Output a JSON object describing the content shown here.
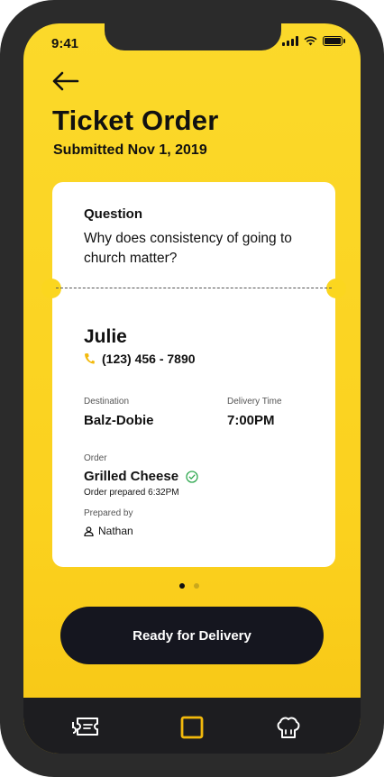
{
  "status": {
    "time": "9:41"
  },
  "header": {
    "title": "Ticket Order",
    "subtitle": "Submitted Nov 1, 2019"
  },
  "card": {
    "question_label": "Question",
    "question_text": "Why does consistency of going to church matter?",
    "customer_name": "Julie",
    "phone": "(123) 456 - 7890",
    "destination_label": "Destination",
    "destination": "Balz-Dobie",
    "delivery_time_label": "Delivery Time",
    "delivery_time": "7:00PM",
    "order_label": "Order",
    "order_item": "Grilled Cheese",
    "order_prepared": "Order prepared 6:32PM",
    "prepared_by_label": "Prepared by",
    "prepared_by": "Nathan"
  },
  "pager": {
    "count": 2,
    "active": 1
  },
  "cta": {
    "label": "Ready for Delivery"
  },
  "tabbar": {
    "items": [
      {
        "icon": "ticket-icon",
        "active": false
      },
      {
        "icon": "square-icon",
        "active": true
      },
      {
        "icon": "chef-hat-icon",
        "active": false
      }
    ]
  },
  "colors": {
    "background": "#fbd61f",
    "accent": "#f2b90c",
    "dark": "#15161f",
    "success": "#2fa84f"
  }
}
